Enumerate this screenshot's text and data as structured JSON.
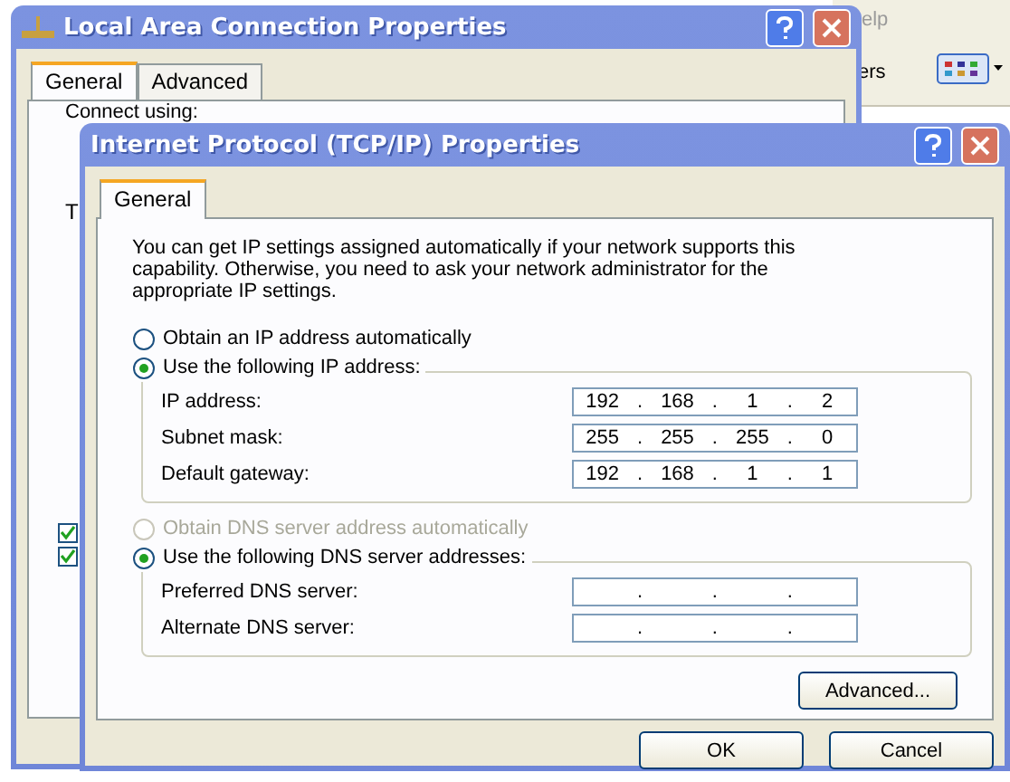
{
  "background_window": {
    "menu_fragment": "elp",
    "toolbar_fragment": "ers"
  },
  "back_dialog": {
    "title": "Local Area Connection Properties",
    "tabs": [
      {
        "label": "General",
        "selected": true
      },
      {
        "label": "Advanced",
        "selected": false
      }
    ],
    "connect_label": "Connect using:",
    "cut_label": "T",
    "checkboxes": [
      {
        "checked": true
      },
      {
        "checked": true
      }
    ]
  },
  "dialog": {
    "title": "Internet Protocol (TCP/IP) Properties",
    "tabs": [
      {
        "label": "General",
        "selected": true
      }
    ],
    "intro": "You can get IP settings assigned automatically if your network supports this capability. Otherwise, you need to ask your network administrator for the appropriate IP settings.",
    "ip_options": [
      {
        "label": "Obtain an IP address automatically",
        "selected": false,
        "disabled": false
      },
      {
        "label": "Use the following IP address:",
        "selected": true,
        "disabled": false
      }
    ],
    "ip_fields": [
      {
        "label": "IP address:",
        "octets": [
          "192",
          "168",
          "1",
          "2"
        ],
        "separators": [
          ".",
          ".",
          "."
        ]
      },
      {
        "label": "Subnet mask:",
        "octets": [
          "255",
          "255",
          "255",
          "0"
        ],
        "separators": [
          ".",
          ".",
          "."
        ]
      },
      {
        "label": "Default gateway:",
        "octets": [
          "192",
          "168",
          "1",
          "1"
        ],
        "separators": [
          ".",
          ".",
          "."
        ]
      }
    ],
    "dns_options": [
      {
        "label": "Obtain DNS server address automatically",
        "selected": false,
        "disabled": true
      },
      {
        "label": "Use the following DNS server addresses:",
        "selected": true,
        "disabled": false
      }
    ],
    "dns_fields": [
      {
        "label": "Preferred DNS server:",
        "separators": [
          ".",
          ".",
          "."
        ]
      },
      {
        "label": "Alternate DNS server:",
        "separators": [
          ".",
          ".",
          "."
        ]
      }
    ],
    "advanced_button": "Advanced...",
    "buttons": [
      "OK",
      "Cancel"
    ]
  }
}
